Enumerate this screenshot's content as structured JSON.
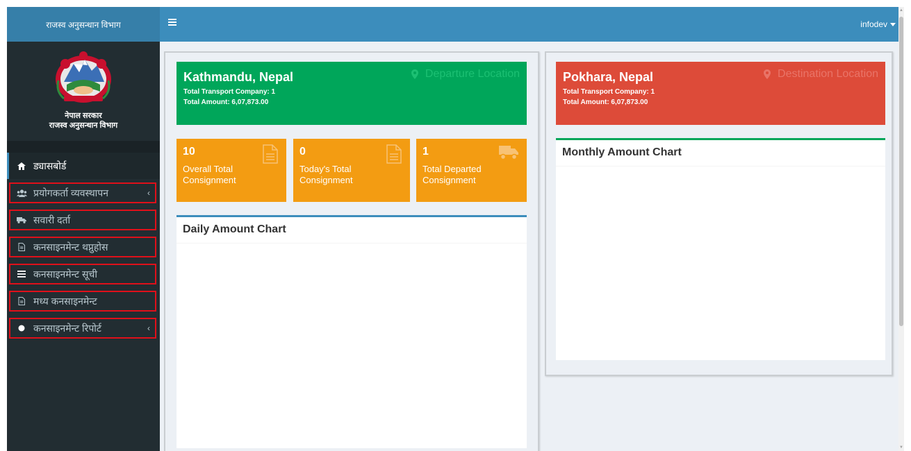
{
  "brand": {
    "title": "राजस्व अनुसन्धान विभाग"
  },
  "logo": {
    "line1": "नेपाल सरकार",
    "line2": "राजस्व अनुसन्धान विभाग",
    "icon": "nepal-emblem"
  },
  "sidebar": {
    "items": [
      {
        "label": "ड्यासबोर्ड",
        "icon": "home-icon",
        "chevron": false,
        "active": true,
        "boxed": false
      },
      {
        "label": "प्रयोगकर्ता व्यवस्थापन",
        "icon": "users-icon",
        "chevron": true,
        "active": false,
        "boxed": true
      },
      {
        "label": "सवारी दर्ता",
        "icon": "truck-icon",
        "chevron": false,
        "active": false,
        "boxed": true
      },
      {
        "label": "कनसाइनमेन्ट थप्नुहोस",
        "icon": "file-icon",
        "chevron": false,
        "active": false,
        "boxed": true
      },
      {
        "label": "कनसाइनमेन्ट सूची",
        "icon": "list-icon",
        "chevron": false,
        "active": false,
        "boxed": true
      },
      {
        "label": "मध्य कनसाइनमेन्ट",
        "icon": "file-icon",
        "chevron": false,
        "active": false,
        "boxed": true
      },
      {
        "label": "कनसाइनमेन्ट रिपोर्ट",
        "icon": "circle-icon",
        "chevron": true,
        "active": false,
        "boxed": true
      }
    ],
    "chevron_glyph": "‹"
  },
  "topbar": {
    "user": "infodev",
    "menu_icon": "hamburger-icon"
  },
  "departure": {
    "city": "Kathmandu, Nepal",
    "tag": "Departure Location",
    "company_line": "Total Transport Company: 1",
    "amount_line": "Total Amount: 6,07,873.00",
    "color": "#00a65a"
  },
  "destination": {
    "city": "Pokhara, Nepal",
    "tag": "Destination Location",
    "company_line": "Total Transport Company: 1",
    "amount_line": "Total Amount: 6,07,873.00",
    "color": "#dd4b39"
  },
  "stats": [
    {
      "value": "10",
      "label": "Overall Total Consignment",
      "icon": "file-icon"
    },
    {
      "value": "0",
      "label": "Today's Total Consignment",
      "icon": "file-icon"
    },
    {
      "value": "1",
      "label": "Total Departed Consignment",
      "icon": "truck-icon"
    }
  ],
  "charts": {
    "daily_title": "Daily Amount Chart",
    "monthly_title": "Monthly Amount Chart"
  },
  "colors": {
    "accent": "#3c8dbc",
    "sidebar": "#222d32",
    "stat": "#f39c12",
    "highlight_box": "#e0101a"
  }
}
